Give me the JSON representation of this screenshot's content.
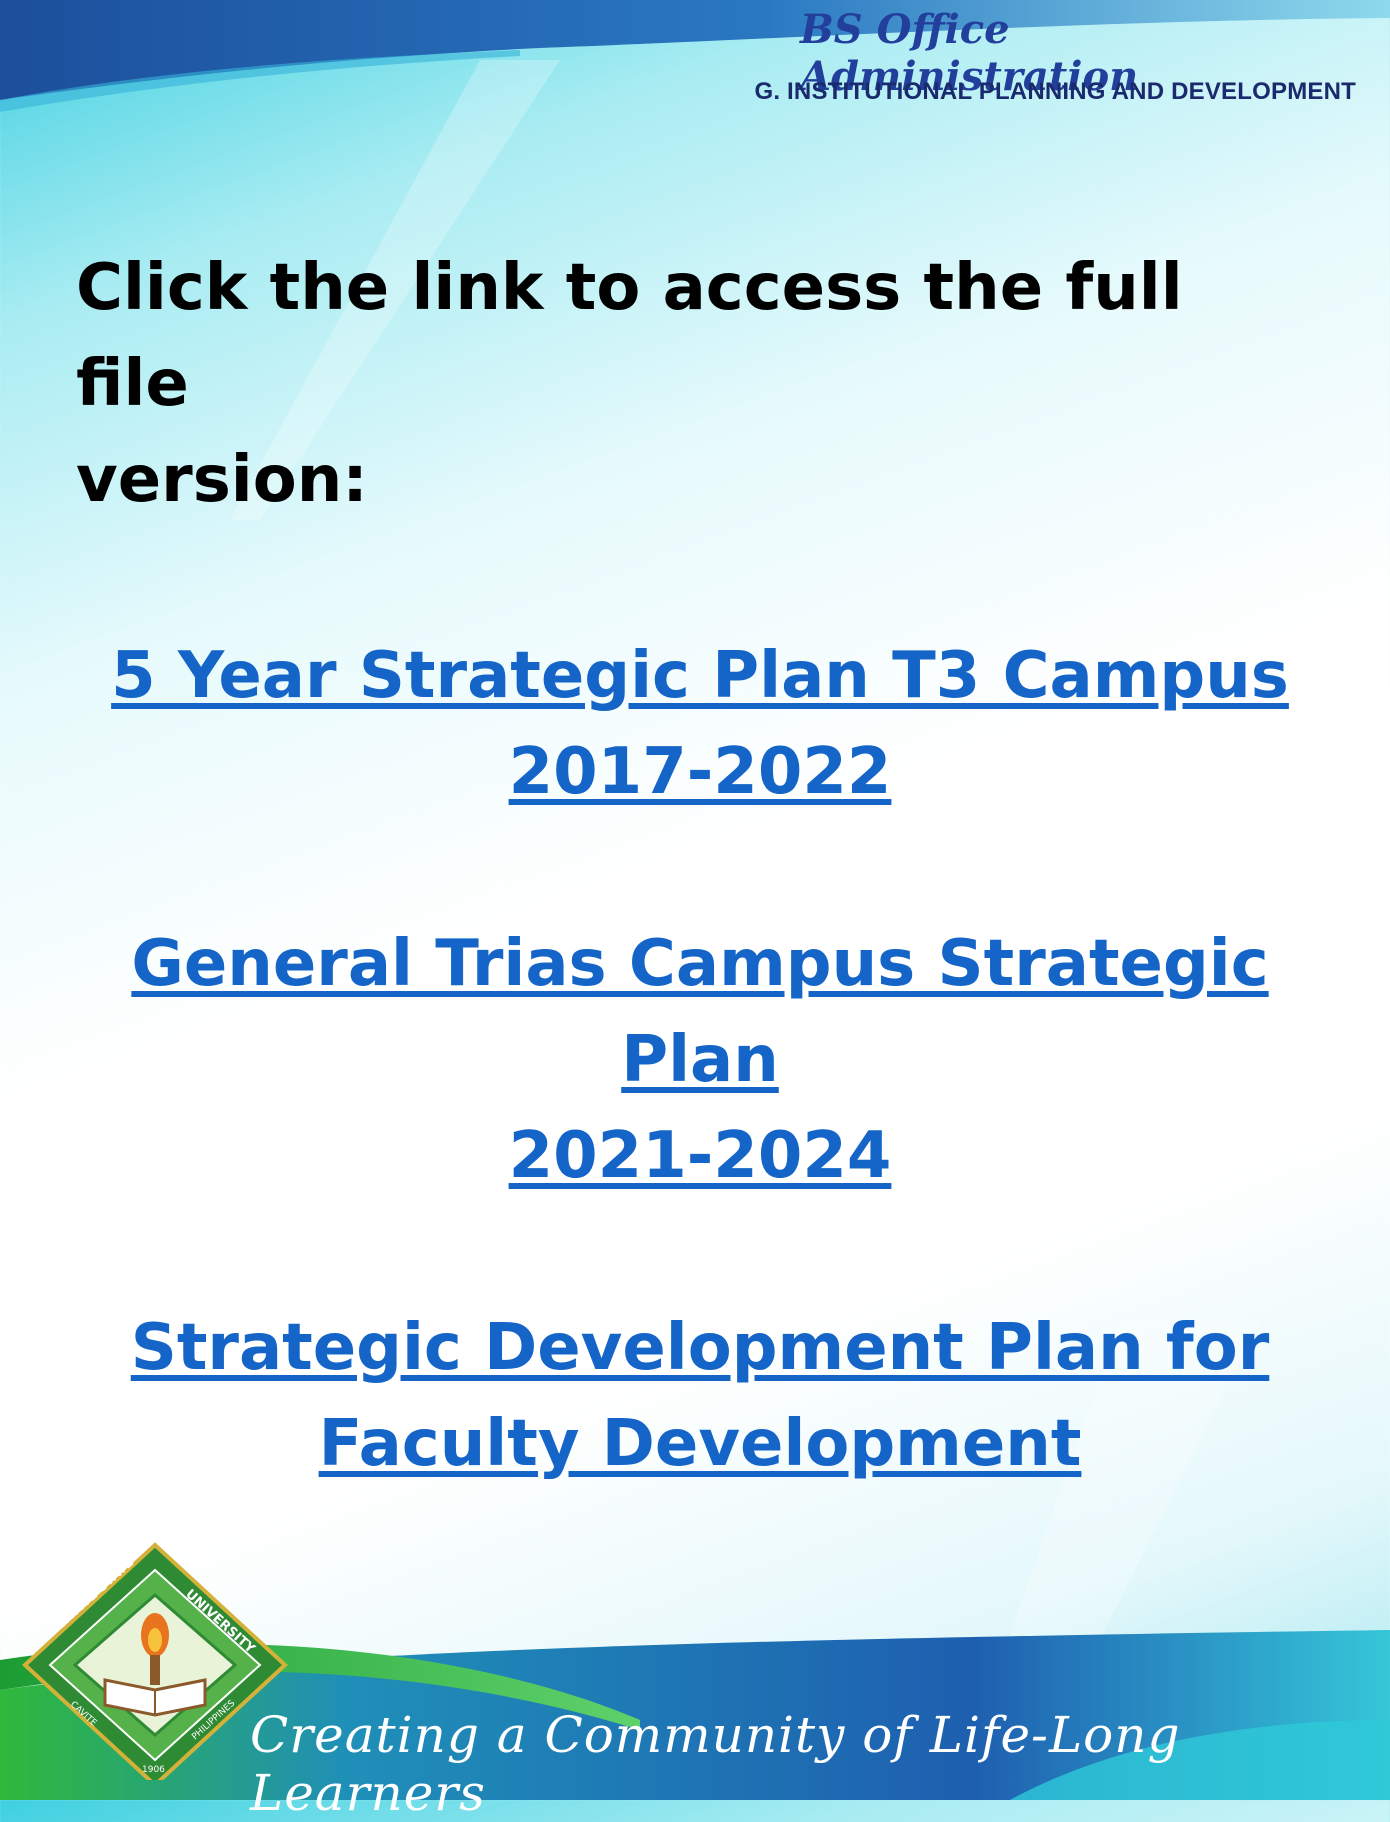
{
  "header": {
    "course": "BS Office Administration",
    "section": "G. INSTITUTIONAL PLANNING AND DEVELOPMENT"
  },
  "main": {
    "instruction_line1": "Click the link to access the full file",
    "instruction_line2": "version:",
    "links": [
      {
        "line1": "5 Year Strategic Plan T3 Campus",
        "line2": "2017-2022"
      },
      {
        "line1": "General Trias Campus Strategic Plan",
        "line2": "2021-2024"
      },
      {
        "line1": "Strategic Development Plan for",
        "line2": "Faculty Development"
      }
    ]
  },
  "footer": {
    "tagline": "Creating a Community of Life-Long Learners",
    "logo": {
      "top_text": "UNIVERSITY",
      "left_text": "CAVITE STATE",
      "bottom_left_text": "CAVITE",
      "bottom_right_text": "PHILIPPINES",
      "year": "1906"
    }
  },
  "colors": {
    "link": "#1565c8",
    "header_blue": "#223f9b",
    "band_blue": "#1f5fb0",
    "logo_green": "#3f8f3a"
  }
}
